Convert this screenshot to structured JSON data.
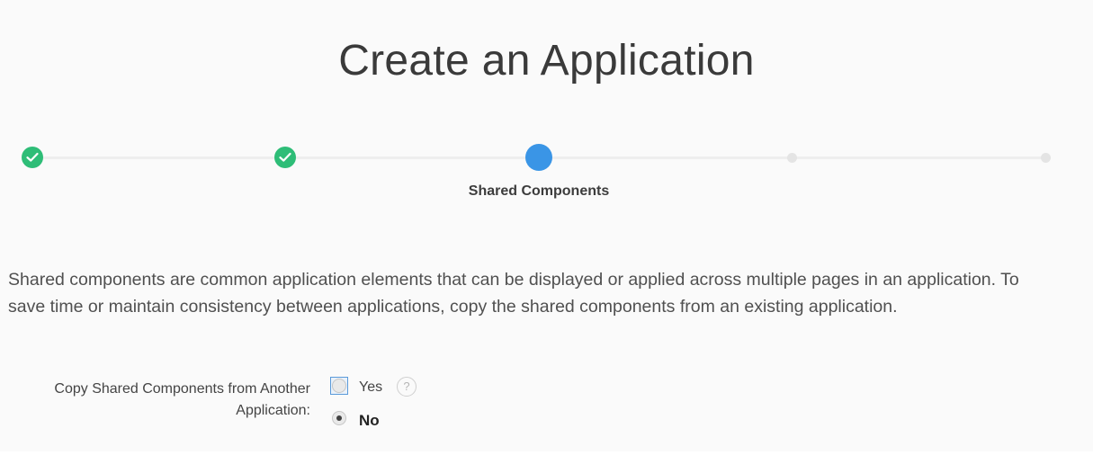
{
  "page": {
    "title": "Create an Application"
  },
  "wizard": {
    "steps": [
      {
        "status": "complete",
        "icon": "check-icon"
      },
      {
        "status": "complete",
        "icon": "check-icon"
      },
      {
        "status": "current",
        "label": "Shared Components"
      },
      {
        "status": "upcoming"
      },
      {
        "status": "upcoming"
      }
    ],
    "current_label": "Shared Components"
  },
  "content": {
    "description": "Shared components are common application elements that can be displayed or applied across multiple pages in an application. To save time or maintain consistency between applications, copy the shared components from an existing application."
  },
  "form": {
    "copy_shared": {
      "label": "Copy Shared Components from Another Application:",
      "options": [
        {
          "label": "Yes",
          "selected": false,
          "focused": true
        },
        {
          "label": "No",
          "selected": true
        }
      ],
      "help_icon": "?"
    }
  },
  "colors": {
    "complete": "#2ebd77",
    "current": "#3a95e6",
    "upcoming": "#e4e4e4"
  }
}
